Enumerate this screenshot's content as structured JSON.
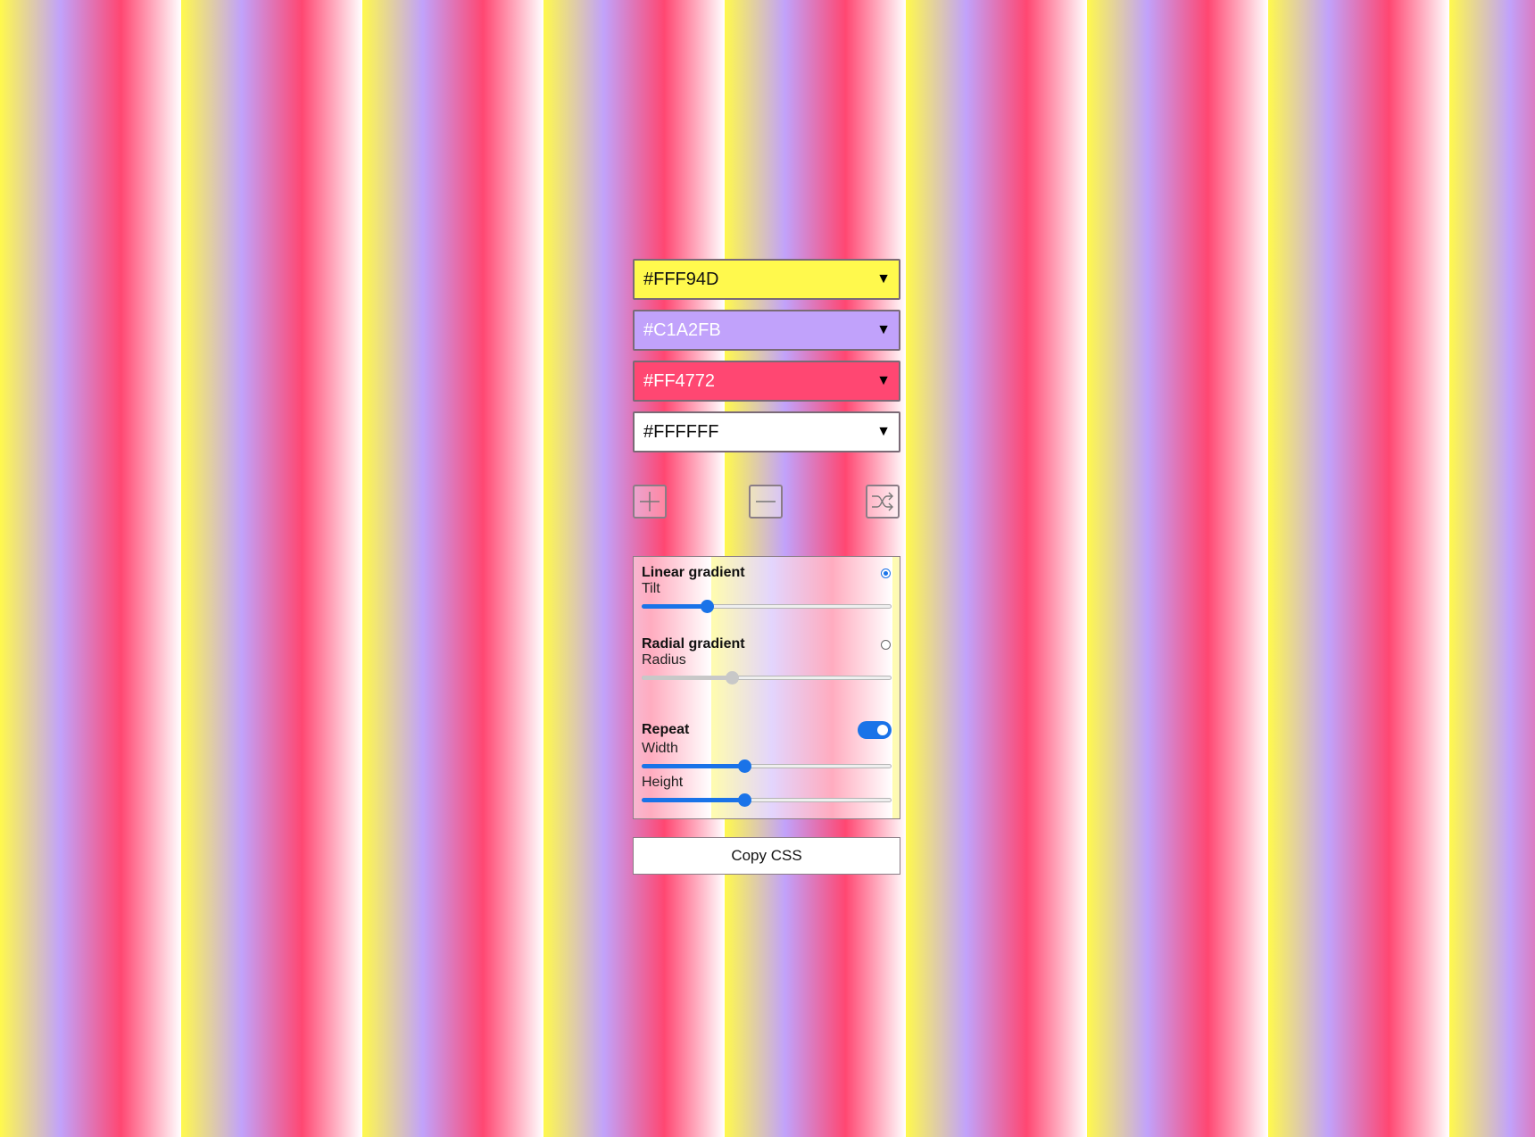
{
  "colors": [
    {
      "hex": "#FFF94D",
      "text_color": "#111111"
    },
    {
      "hex": "#C1A2FB",
      "text_color": "#ffffff"
    },
    {
      "hex": "#FF4772",
      "text_color": "#ffffff"
    },
    {
      "hex": "#FFFFFF",
      "text_color": "#111111"
    }
  ],
  "caret": "▼",
  "buttons": {
    "add_icon": "plus-icon",
    "remove_icon": "minus-icon",
    "shuffle_icon": "shuffle-icon"
  },
  "options": {
    "linear": {
      "title": "Linear gradient",
      "sub": "Tilt",
      "selected": true,
      "value": 0.26
    },
    "radial": {
      "title": "Radial gradient",
      "sub": "Radius",
      "selected": false,
      "value": 0.36
    },
    "repeat": {
      "title": "Repeat",
      "enabled": true,
      "width_label": "Width",
      "width_value": 0.41,
      "height_label": "Height",
      "height_value": 0.41
    }
  },
  "copy_label": "Copy CSS",
  "accent": "#1a73e8"
}
